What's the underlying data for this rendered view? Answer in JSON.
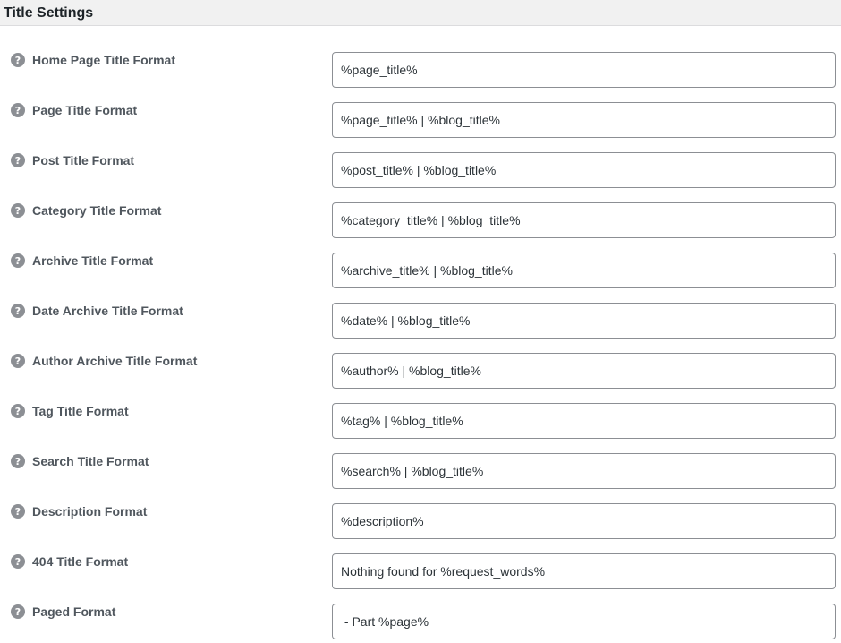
{
  "header": {
    "title": "Title Settings"
  },
  "help_icon_glyph": "?",
  "rows": [
    {
      "label": "Home Page Title Format",
      "value": "%page_title%"
    },
    {
      "label": "Page Title Format",
      "value": "%page_title% | %blog_title%"
    },
    {
      "label": "Post Title Format",
      "value": "%post_title% | %blog_title%"
    },
    {
      "label": "Category Title Format",
      "value": "%category_title% | %blog_title%"
    },
    {
      "label": "Archive Title Format",
      "value": "%archive_title% | %blog_title%"
    },
    {
      "label": "Date Archive Title Format",
      "value": "%date% | %blog_title%"
    },
    {
      "label": "Author Archive Title Format",
      "value": "%author% | %blog_title%"
    },
    {
      "label": "Tag Title Format",
      "value": "%tag% | %blog_title%"
    },
    {
      "label": "Search Title Format",
      "value": "%search% | %blog_title%"
    },
    {
      "label": "Description Format",
      "value": "%description%"
    },
    {
      "label": "404 Title Format",
      "value": "Nothing found for %request_words%"
    },
    {
      "label": "Paged Format",
      "value": " - Part %page%"
    }
  ],
  "icons": {
    "help": "question-mark-circle-icon"
  }
}
